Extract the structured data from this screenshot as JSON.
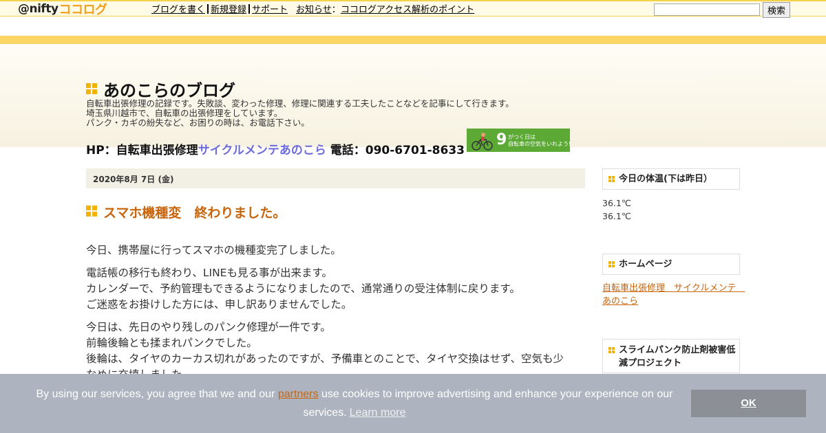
{
  "topbar": {
    "logo_at": "@nifty",
    "logo_coco": "ココログ",
    "nav": [
      "ブログを書く",
      "新規登録",
      "サポート"
    ],
    "news_label": "お知らせ",
    "news_link": "ココログアクセス解析のポイント",
    "search_button": "検索",
    "search_value": ""
  },
  "header": {
    "title": "あのこらのブログ",
    "desc": [
      "自転車出張修理の記録です。失敗談、変わった修理、修理に関連する工夫したことなどを記事にして行きます。",
      "埼玉県川越市で、自転車の出張修理をしています。",
      "パンク・カギの紛失など、お困りの時は、お電話下さい。"
    ],
    "hp_prefix": "HP：自転車出張修理",
    "hp_link": "サイクルメンテあのこら",
    "phone": " 電話：090-6701-8633",
    "banner_num": "9",
    "banner_line1": "がつく日は",
    "banner_line2": "自転車の空気をいれよう!"
  },
  "main": {
    "date": "2020年8月 7日 (金)",
    "entry_title": "スマホ機種変　終わりました。",
    "paragraphs": [
      [
        "今日、携帯屋に行ってスマホの機種変完了しました。"
      ],
      [
        "電話帳の移行も終わり、LINEも見る事が出来ます。",
        "カレンダーで、予約管理もできるようになりましたので、通常通りの受注体制に戻ります。",
        "ご迷惑をお掛けした方には、申し訳ありませんでした。"
      ],
      [
        "今日は、先日のやり残しのパンク修理が一件です。",
        "前輪後輪とも揉まれパンクでした。",
        "後輪は、タイヤのカーカス切れがあったのですが、予備車とのことで、タイヤ交換はせず、空気も少",
        "なめに充填しました。"
      ]
    ]
  },
  "sidebar": {
    "temp_title": "今日の体温(下は昨日）",
    "temp_values": [
      "36.1℃",
      "36.1℃"
    ],
    "home_title": "ホームページ",
    "home_link": "自転車出張修理　サイクルメンテ　あのこら",
    "slime_title": "スライムパンク防止剤被害低減プロジェクト"
  },
  "cookie": {
    "text_before": "By using our services, you agree that we and our ",
    "partners": "partners",
    "text_after": " use cookies to improve advertising and enhance your experience on our services.",
    "learn_more": "Learn more",
    "ok": "OK"
  },
  "colors": {
    "accent_orange": "#c8640c",
    "link_blue": "#6b6bdc",
    "stripe_yellow": "#fcd665",
    "icon_yellow": "#f2b400",
    "cookie_bg": "#adb4bf"
  }
}
